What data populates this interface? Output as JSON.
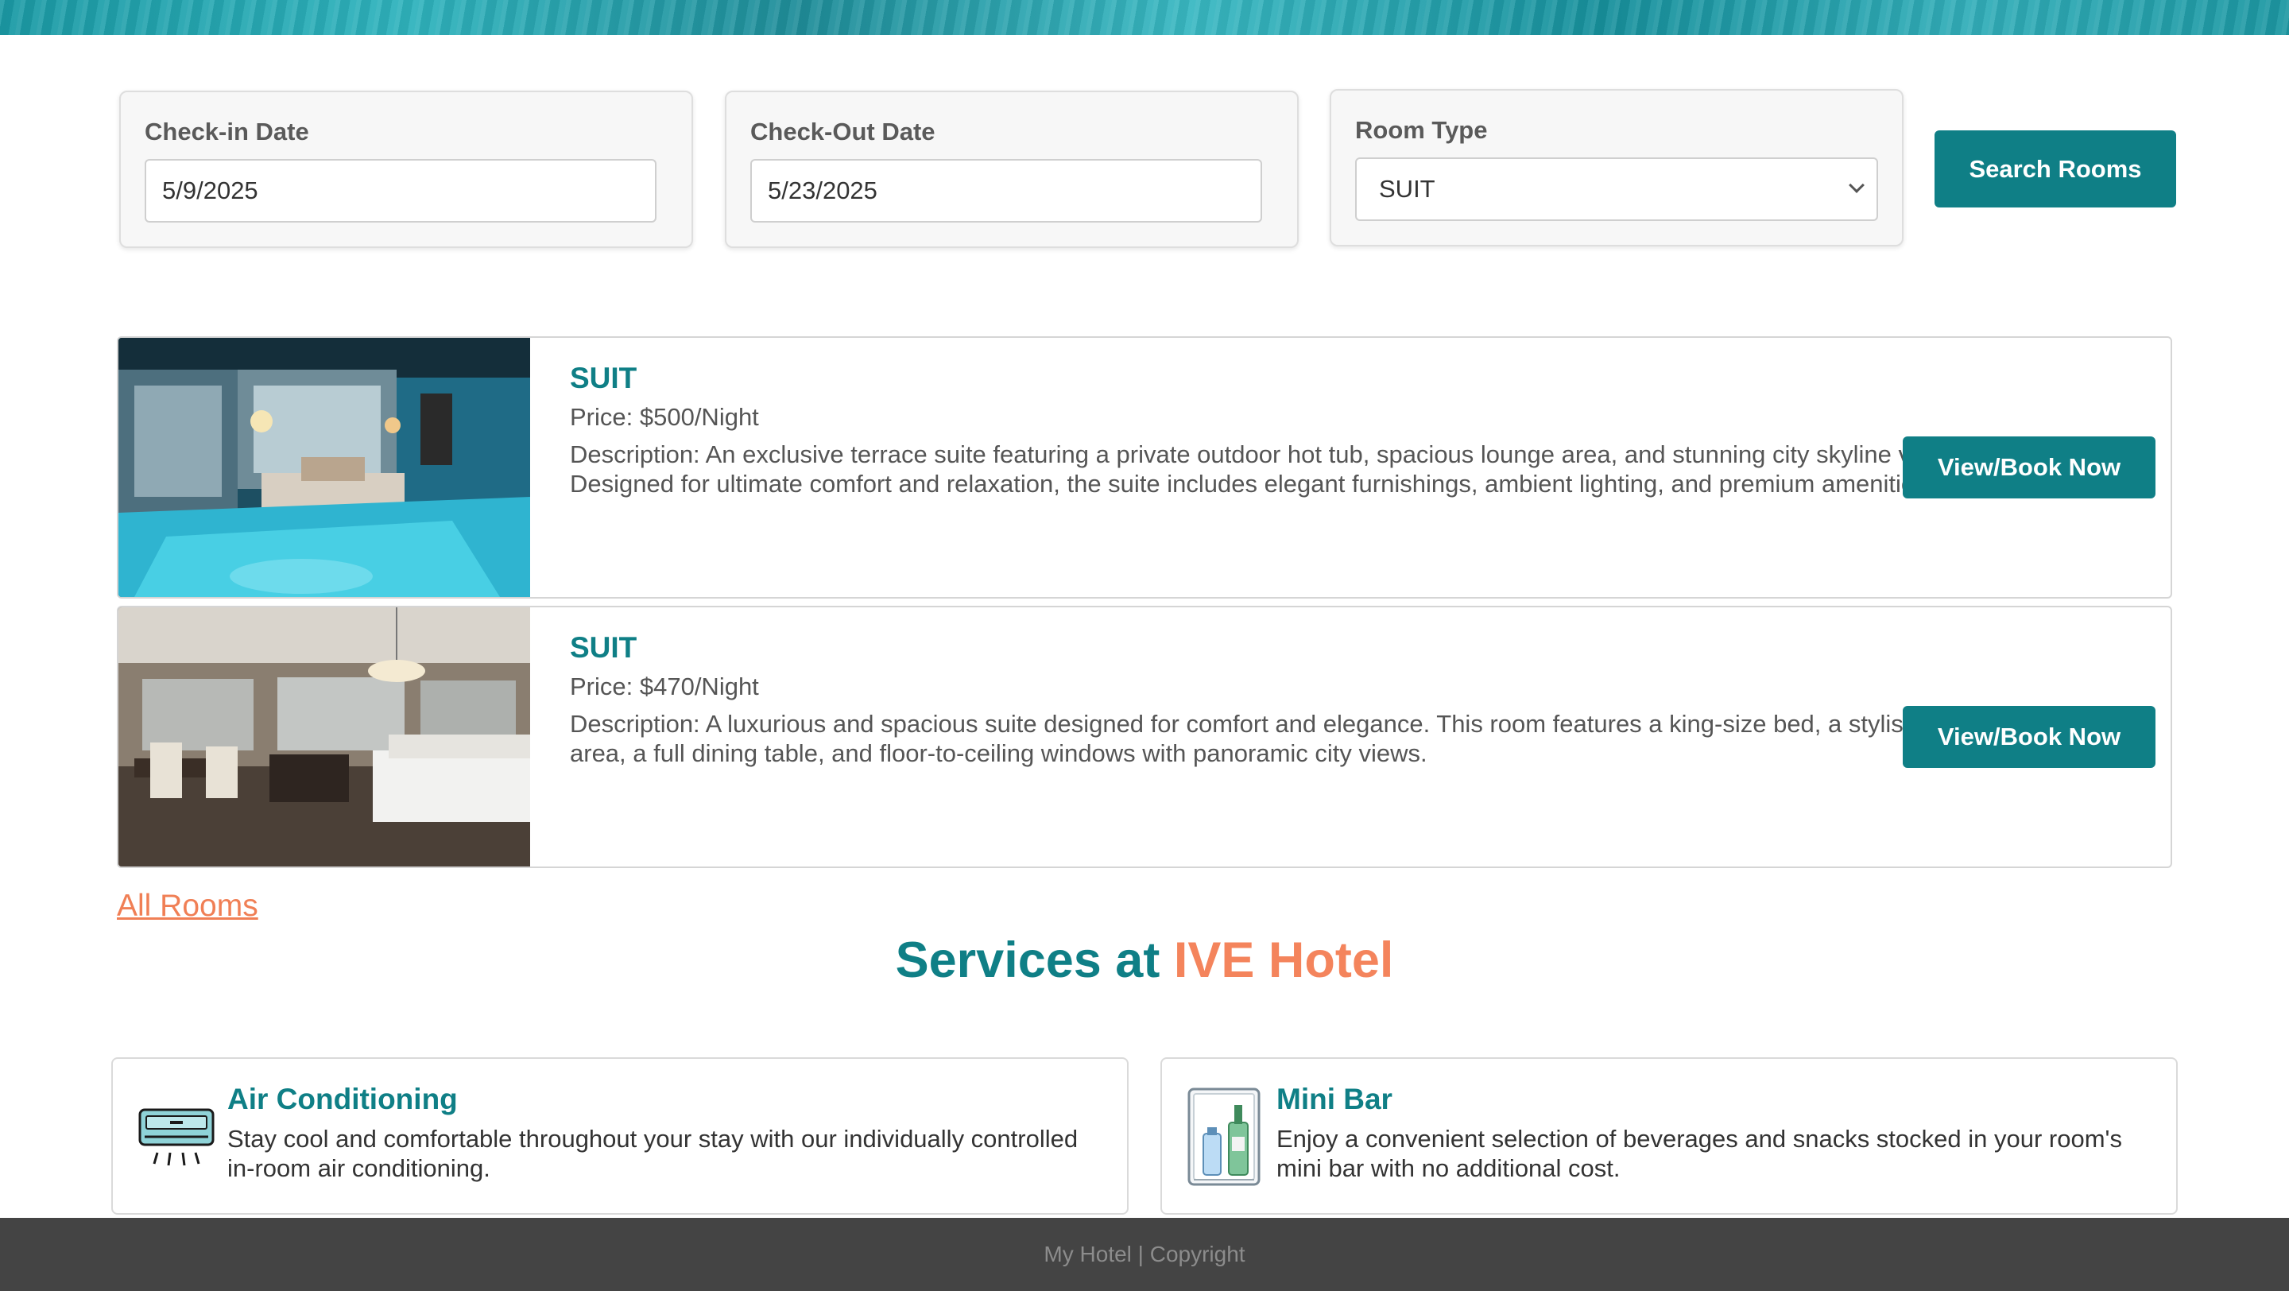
{
  "search": {
    "checkin_label": "Check-in Date",
    "checkin_value": "5/9/2025",
    "checkout_label": "Check-Out Date",
    "checkout_value": "5/23/2025",
    "roomtype_label": "Room Type",
    "roomtype_value": "SUIT",
    "button": "Search Rooms"
  },
  "rooms": [
    {
      "title": "SUIT",
      "price": "Price: $500/Night",
      "description": "Description: An exclusive terrace suite featuring a private outdoor hot tub, spacious lounge area, and stunning city skyline views. Designed for ultimate comfort and relaxation, the suite includes elegant furnishings, ambient lighting, and premium amenities.",
      "button": "View/Book Now"
    },
    {
      "title": "SUIT",
      "price": "Price: $470/Night",
      "description": "Description: A luxurious and spacious suite designed for comfort and elegance. This room features a king-size bed, a stylish living area, a full dining table, and floor-to-ceiling windows with panoramic city views.",
      "button": "View/Book Now"
    }
  ],
  "all_rooms_link": "All Rooms",
  "services": {
    "title_prefix": "Services at ",
    "title_accent": "IVE Hotel",
    "items": [
      {
        "title": "Air Conditioning",
        "description": "Stay cool and comfortable throughout your stay with our individually controlled in-room air conditioning.",
        "icon": "air-conditioner-icon"
      },
      {
        "title": "Mini Bar",
        "description": "Enjoy a convenient selection of beverages and snacks stocked in your room's mini bar with no additional cost.",
        "icon": "mini-fridge-icon"
      }
    ]
  },
  "footer": "My Hotel | Copyright",
  "colors": {
    "primary": "#0f7f86",
    "accent": "#f4845c",
    "footer_bg": "#444444"
  }
}
